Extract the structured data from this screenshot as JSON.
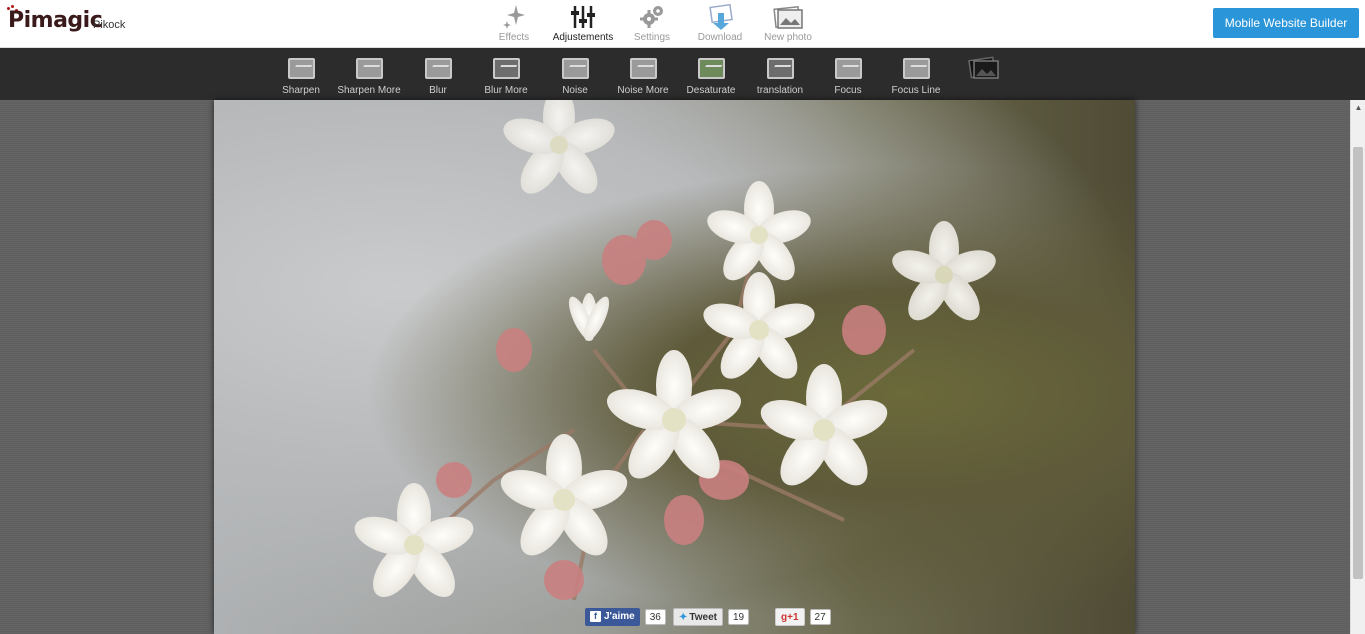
{
  "header": {
    "logo": "Pimagic",
    "site_name": "Pikock",
    "nav": [
      {
        "label": "Effects",
        "icon": "sparkle-icon"
      },
      {
        "label": "Adjustements",
        "icon": "sliders-icon",
        "active": true
      },
      {
        "label": "Settings",
        "icon": "gears-icon"
      },
      {
        "label": "Download",
        "icon": "download-icon"
      },
      {
        "label": "New photo",
        "icon": "photo-icon"
      }
    ],
    "cta": "Mobile Website Builder"
  },
  "toolbar": {
    "tools": [
      {
        "label": "Sharpen"
      },
      {
        "label": "Sharpen More"
      },
      {
        "label": "Blur"
      },
      {
        "label": "Blur More"
      },
      {
        "label": "Noise"
      },
      {
        "label": "Noise More"
      },
      {
        "label": "Desaturate"
      },
      {
        "label": "translation"
      },
      {
        "label": "Focus"
      },
      {
        "label": "Focus Line"
      }
    ]
  },
  "share": {
    "facebook": {
      "label": "J'aime",
      "count": "36"
    },
    "twitter": {
      "label": "Tweet",
      "count": "19"
    },
    "google": {
      "label": "+1",
      "count": "27"
    }
  },
  "colors": {
    "accent": "#2a95d8",
    "toolbar_bg": "#2c2c2c",
    "facebook": "#3b5998"
  }
}
